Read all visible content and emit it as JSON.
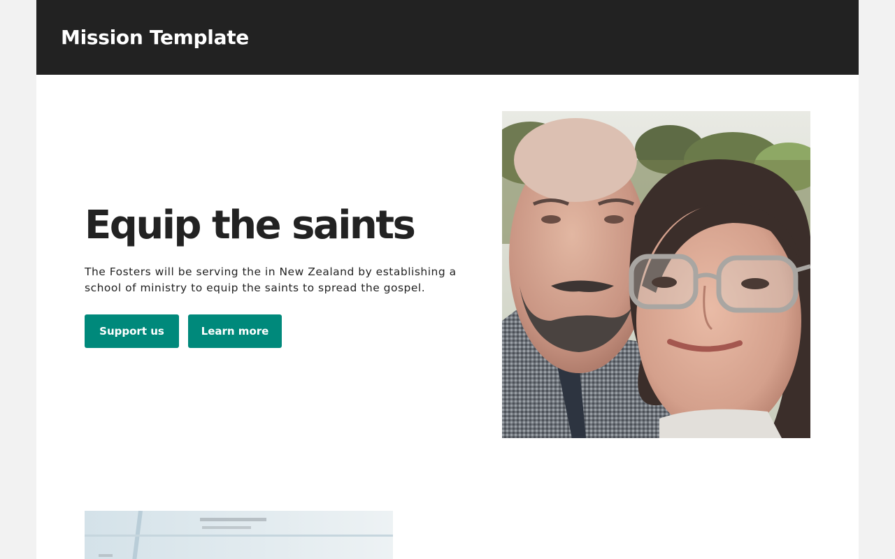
{
  "header": {
    "site_title": "Mission Template"
  },
  "hero": {
    "heading": "Equip the saints",
    "description": "The Fosters will be serving the in New Zealand by establishing a school of ministry to equip the saints to spread the gospel.",
    "primary_button": "Support us",
    "secondary_button": "Learn more"
  },
  "colors": {
    "header_background": "#222222",
    "accent": "#00897b",
    "page_background": "#ffffff",
    "outer_background": "#f2f2f2",
    "heading_text": "#222222"
  }
}
